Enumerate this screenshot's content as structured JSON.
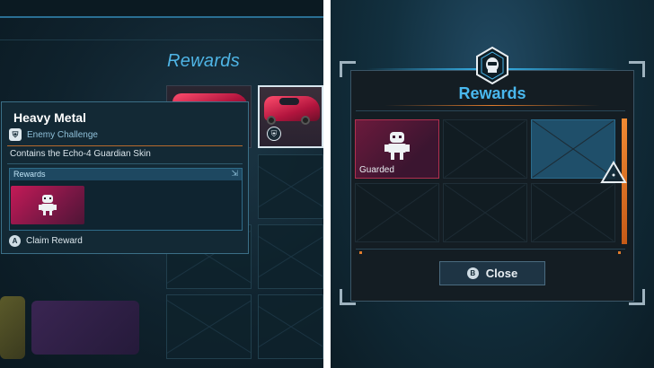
{
  "left_panel": {
    "heading": "Rewards",
    "tooltip": {
      "title": "Heavy Metal",
      "type_badge": "⛨",
      "type_label": "Enemy Challenge",
      "description": "Contains the Echo-4 Guardian Skin",
      "rewards_label": "Rewards",
      "rewards_corner": "⇲",
      "claim_key": "A",
      "claim_label": "Claim Reward"
    },
    "selected_slot_badge": "⛨"
  },
  "right_panel": {
    "heading": "Rewards",
    "slot_1_label": "Guarded",
    "close_key": "B",
    "close_label": "Close"
  },
  "icons": {
    "emblem": "helmet-hex-emblem-icon",
    "robot": "guardian-robot-icon",
    "pointer": "triangle-cursor-icon"
  },
  "colors": {
    "accent_blue": "#49b8ee",
    "accent_orange": "#e07b2c",
    "guarded_pink": "#c41a57"
  }
}
